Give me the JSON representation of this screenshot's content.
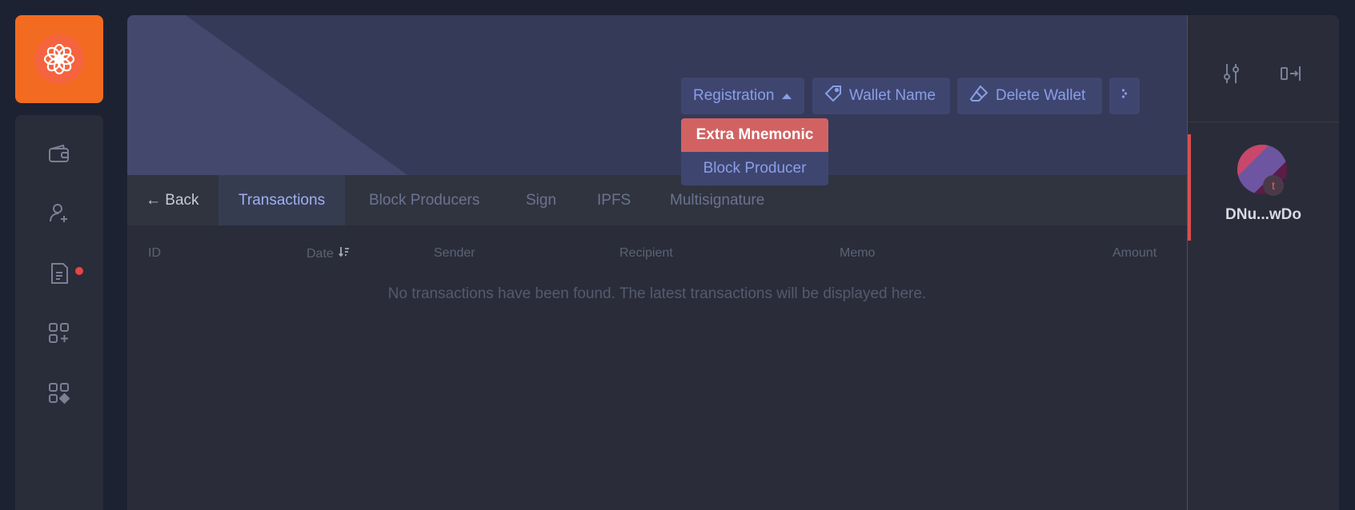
{
  "colors": {
    "brand": "#f26b21",
    "accent_red": "#d26262",
    "link_blue": "#8b9ee6",
    "notification": "#e84545"
  },
  "sidebar": {
    "logo_icon": "flower-logo-icon",
    "items": [
      {
        "icon": "wallet-icon"
      },
      {
        "icon": "add-user-icon"
      },
      {
        "icon": "document-icon",
        "has_notification": true
      },
      {
        "icon": "add-app-icon"
      },
      {
        "icon": "apps-icon"
      }
    ]
  },
  "header": {
    "buttons": {
      "registration": "Registration",
      "wallet_name": "Wallet Name",
      "delete_wallet": "Delete Wallet",
      "more": "more-dots-icon"
    },
    "dropdown": {
      "items": [
        "Extra Mnemonic",
        "Block Producer"
      ],
      "highlighted": "Extra Mnemonic"
    }
  },
  "tabs": {
    "back": "← Back",
    "items": [
      "Transactions",
      "Block Producers",
      "Sign",
      "IPFS",
      "Multisignature"
    ],
    "active": "Transactions"
  },
  "table": {
    "columns": [
      "ID",
      "Date",
      "Sender",
      "Recipient",
      "Memo",
      "Amount"
    ],
    "sort_column": "Date",
    "empty_message": "No transactions have been found. The latest transactions will be displayed here."
  },
  "right_panel": {
    "icons": [
      "sliders-icon",
      "collapse-panel-icon"
    ],
    "wallet": {
      "name": "DNu...wDo",
      "badge": "t"
    }
  }
}
